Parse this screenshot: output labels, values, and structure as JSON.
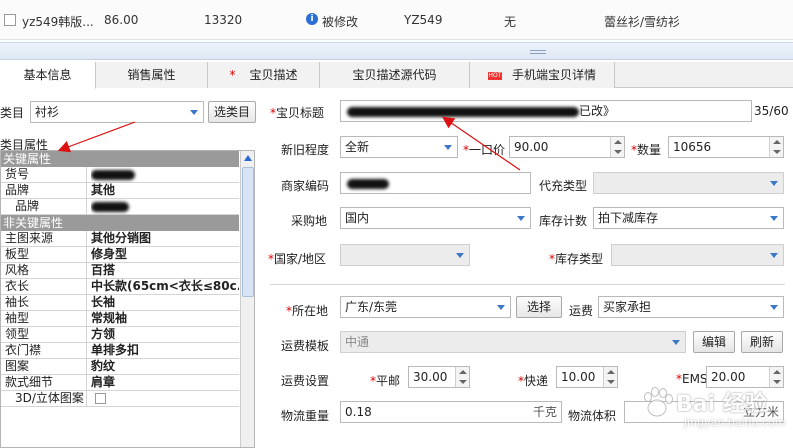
{
  "top_row": {
    "item_name": "yz549韩版...",
    "price": "86.00",
    "quantity": "13320",
    "status": "被修改",
    "code": "YZ549",
    "extra": "无",
    "category_path": "蕾丝衫/雪纺衫"
  },
  "tabs": [
    {
      "label": "基本信息",
      "active": true
    },
    {
      "label": "销售属性",
      "active": false
    },
    {
      "label": "宝贝描述",
      "required": true
    },
    {
      "label": "宝贝描述源代码"
    },
    {
      "label": "手机端宝贝详情",
      "badge": "HOT"
    }
  ],
  "left": {
    "category_label": "类目",
    "category_value": "衬衫",
    "choose_category_button": "选类目",
    "attrs_label": "类目属性",
    "key_attrs_header": "关键属性",
    "key_attrs": [
      {
        "key": "货号",
        "value": ""
      },
      {
        "key": "品牌",
        "value": "其他"
      },
      {
        "key": "品牌",
        "value": ""
      }
    ],
    "nonkey_attrs_header": "非关键属性",
    "attrs": [
      {
        "key": "主图来源",
        "value": "其他分销图"
      },
      {
        "key": "板型",
        "value": "修身型"
      },
      {
        "key": "风格",
        "value": "百搭"
      },
      {
        "key": "衣长",
        "value": "中长款(65cm<衣长≤80c..."
      },
      {
        "key": "袖长",
        "value": "长袖"
      },
      {
        "key": "袖型",
        "value": "常规袖"
      },
      {
        "key": "领型",
        "value": "方领"
      },
      {
        "key": "衣门襟",
        "value": "单排多扣"
      },
      {
        "key": "图案",
        "value": "豹纹"
      },
      {
        "key": "款式细节",
        "value": "肩章"
      },
      {
        "key": "3D/立体图案",
        "value": ""
      }
    ]
  },
  "form": {
    "title_label": "宝贝标题",
    "title_value_suffix": "已改》",
    "title_counter": "35/60",
    "condition_label": "新旧程度",
    "condition_value": "全新",
    "price_label": "一口价",
    "price_value": "90.00",
    "qty_label": "数量",
    "qty_value": "10656",
    "merchant_code_label": "商家编码",
    "proxy_type_label": "代充类型",
    "origin_label": "采购地",
    "origin_value": "国内",
    "stock_count_label": "库存计数",
    "stock_count_value": "拍下减库存",
    "country_label": "国家/地区",
    "stock_type_label": "库存类型",
    "location_label": "所在地",
    "location_value": "广东/东莞",
    "select_button": "选择",
    "shipping_label": "运费",
    "shipping_value": "买家承担",
    "shipping_template_label": "运费模板",
    "shipping_template_value": "中通",
    "edit_button": "编辑",
    "refresh_button": "刷新",
    "shipping_settings_label": "运费设置",
    "mail_label": "平邮",
    "mail_value": "30.00",
    "express_label": "快递",
    "express_value": "10.00",
    "ems_label": "EMS",
    "ems_value": "20.00",
    "weight_label": "物流重量",
    "weight_value": "0.18",
    "weight_unit": "千克",
    "volume_label": "物流体积",
    "volume_unit": "立方米"
  },
  "watermark": {
    "title": "Bai 经验",
    "subtitle": "jingyan.baidu.com"
  },
  "colors": {
    "accent": "#2a6fd6",
    "required": "#dd0000",
    "annotation": "#dd1111",
    "group_header": "#9a9a9a"
  }
}
